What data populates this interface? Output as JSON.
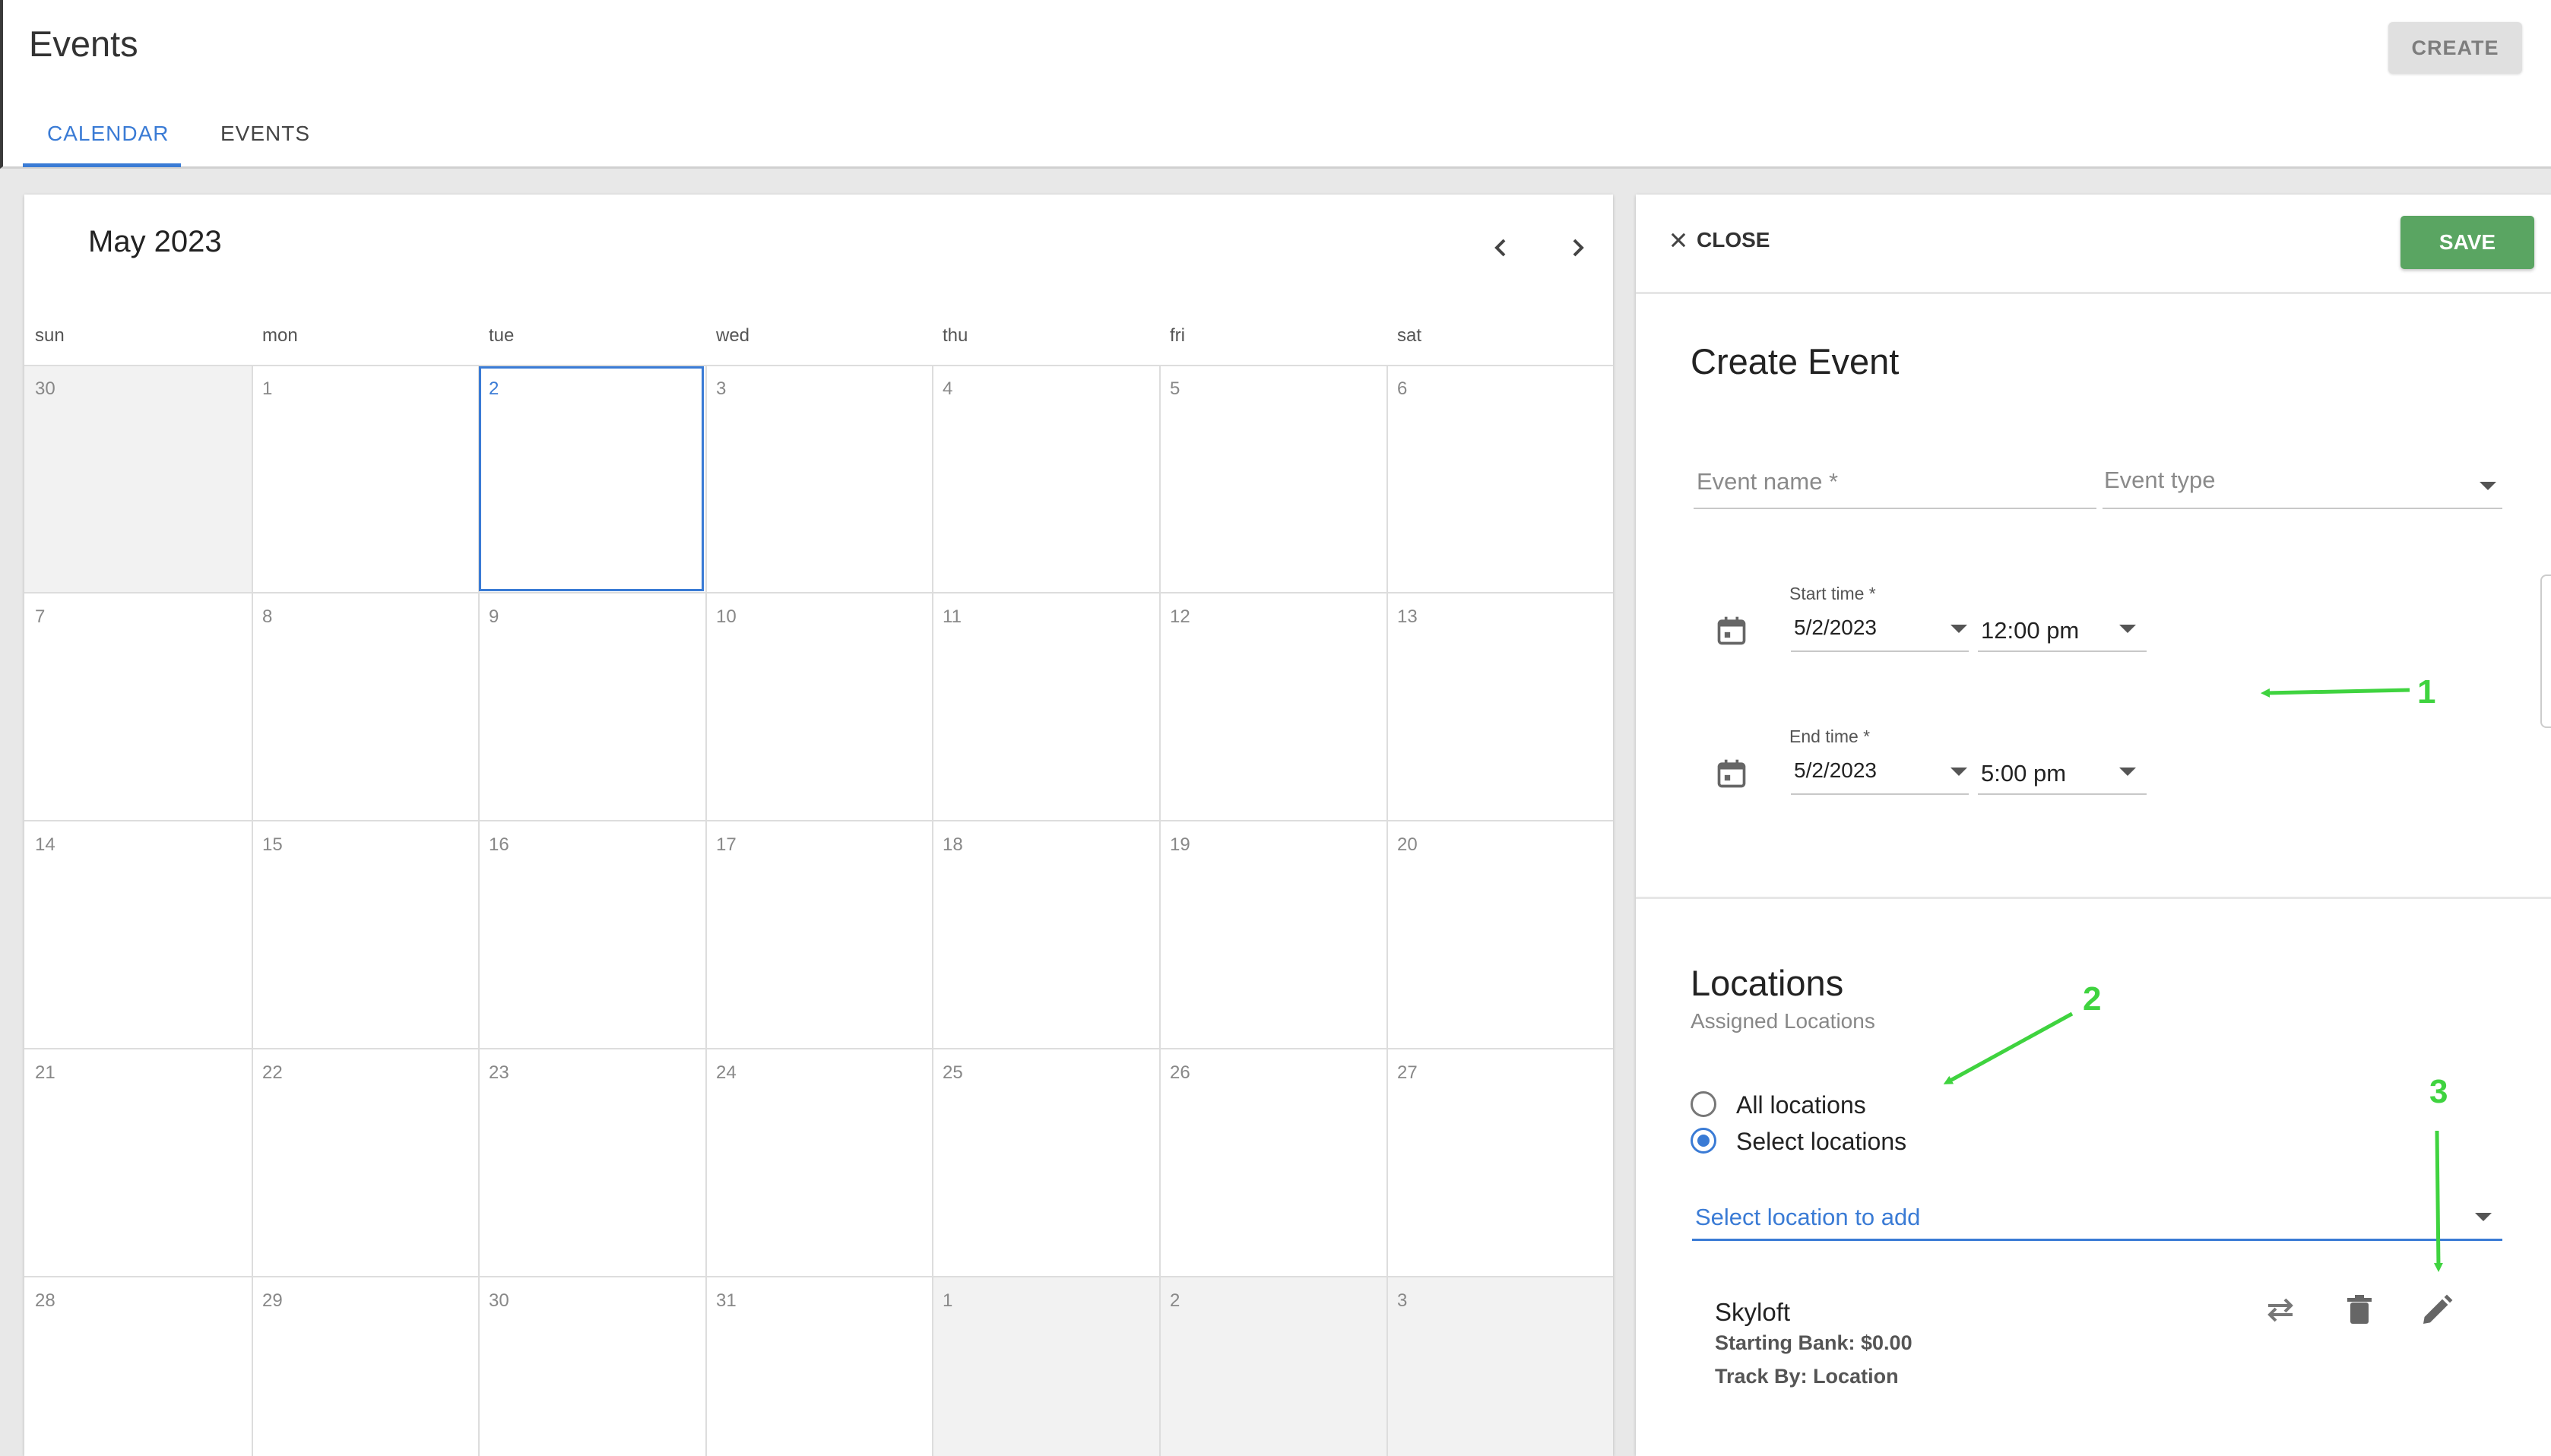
{
  "header": {
    "title": "Events",
    "create_label": "CREATE"
  },
  "tabs": [
    {
      "label": "CALENDAR",
      "active": true
    },
    {
      "label": "EVENTS",
      "active": false
    }
  ],
  "calendar": {
    "month_label": "May 2023",
    "weekdays": [
      "sun",
      "mon",
      "tue",
      "wed",
      "thu",
      "fri",
      "sat"
    ],
    "weeks": [
      [
        "30",
        "1",
        "2",
        "3",
        "4",
        "5",
        "6"
      ],
      [
        "7",
        "8",
        "9",
        "10",
        "11",
        "12",
        "13"
      ],
      [
        "14",
        "15",
        "16",
        "17",
        "18",
        "19",
        "20"
      ],
      [
        "21",
        "22",
        "23",
        "24",
        "25",
        "26",
        "27"
      ],
      [
        "28",
        "29",
        "30",
        "31",
        "1",
        "2",
        "3"
      ]
    ],
    "selected_day": "2"
  },
  "panel": {
    "close_label": "CLOSE",
    "save_label": "SAVE",
    "title": "Create Event",
    "event_name_placeholder": "Event name *",
    "event_type_placeholder": "Event type",
    "start": {
      "label": "Start time *",
      "date": "5/2/2023",
      "time": "12:00 pm"
    },
    "end": {
      "label": "End time *",
      "date": "5/2/2023",
      "time": "5:00 pm"
    },
    "locations": {
      "title": "Locations",
      "subtitle": "Assigned Locations",
      "options": [
        "All locations",
        "Select locations"
      ],
      "selected_option": "Select locations",
      "select_placeholder": "Select location to add",
      "items": [
        {
          "name": "Skyloft",
          "starting_bank": "Starting Bank: $0.00",
          "track_by": "Track By: Location"
        }
      ]
    }
  },
  "annotations": [
    "1",
    "2",
    "3"
  ],
  "colors": {
    "accent": "#3a7bd5",
    "save": "#5aa562",
    "annotation": "#3fd33f"
  }
}
